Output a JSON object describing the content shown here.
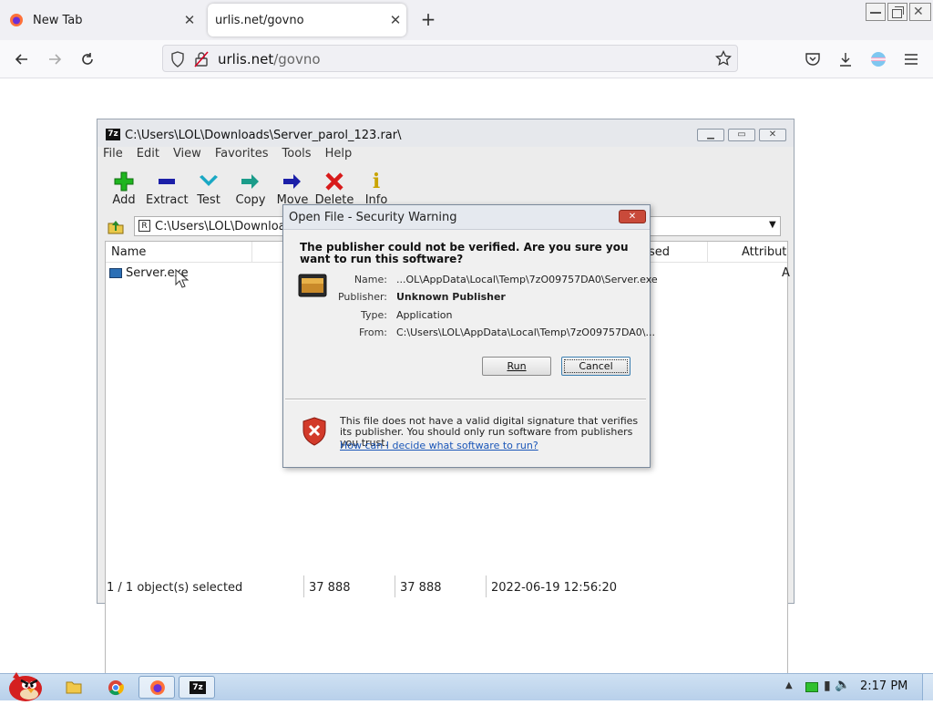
{
  "browser": {
    "tabs": [
      {
        "label": "New Tab",
        "active": false
      },
      {
        "label": "urlis.net/govno",
        "active": true
      }
    ],
    "url": {
      "domain": "urlis.net",
      "path": "/govno"
    },
    "colors": {
      "firefox_orange": "#ff7139",
      "firefox_purple": "#6a2fd6"
    }
  },
  "zip_window": {
    "title": "C:\\Users\\LOL\\Downloads\\Server_parol_123.rar\\",
    "menu": [
      "File",
      "Edit",
      "View",
      "Favorites",
      "Tools",
      "Help"
    ],
    "toolbar": [
      {
        "label": "Add",
        "icon": "plus-icon",
        "color": "#1fb51f"
      },
      {
        "label": "Extract",
        "icon": "minus-icon",
        "color": "#1b1fa8"
      },
      {
        "label": "Test",
        "icon": "check-chevron-icon",
        "color": "#1aa8c4"
      },
      {
        "label": "Copy",
        "icon": "double-arrow-icon",
        "color": "#1b9c8a"
      },
      {
        "label": "Move",
        "icon": "arrow-right-icon",
        "color": "#1b1fa8"
      },
      {
        "label": "Delete",
        "icon": "x-icon",
        "color": "#d81a1a"
      },
      {
        "label": "Info",
        "icon": "info-icon",
        "color": "#c9a400"
      }
    ],
    "path": "C:\\Users\\LOL\\Downloads",
    "columns": {
      "name": "Name",
      "used": "sed",
      "attributes": "Attribute"
    },
    "files": [
      {
        "name": "Server.exe",
        "attr": "A"
      }
    ],
    "status": {
      "selected": "1 / 1 object(s) selected",
      "size": "37 888",
      "packed": "37 888",
      "date": "2022-06-19 12:56:20"
    }
  },
  "dialog": {
    "title": "Open File - Security Warning",
    "question": "The publisher could not be verified.  Are you sure you want to run this software?",
    "fields": [
      {
        "label": "Name:",
        "value": "...OL\\AppData\\Local\\Temp\\7zO09757DA0\\Server.exe",
        "bold": false
      },
      {
        "label": "Publisher:",
        "value": "Unknown Publisher",
        "bold": true
      },
      {
        "label": "Type:",
        "value": "Application",
        "bold": false
      },
      {
        "label": "From:",
        "value": "C:\\Users\\LOL\\AppData\\Local\\Temp\\7zO09757DA0\\...",
        "bold": false
      }
    ],
    "run_label": "Run",
    "cancel_label": "Cancel",
    "warning_text": "This file does not have a valid digital signature that verifies its publisher.  You should only run software from publishers you trust.",
    "help_link": "How can I decide what software to run?"
  },
  "taskbar": {
    "clock": "2:17 PM"
  }
}
